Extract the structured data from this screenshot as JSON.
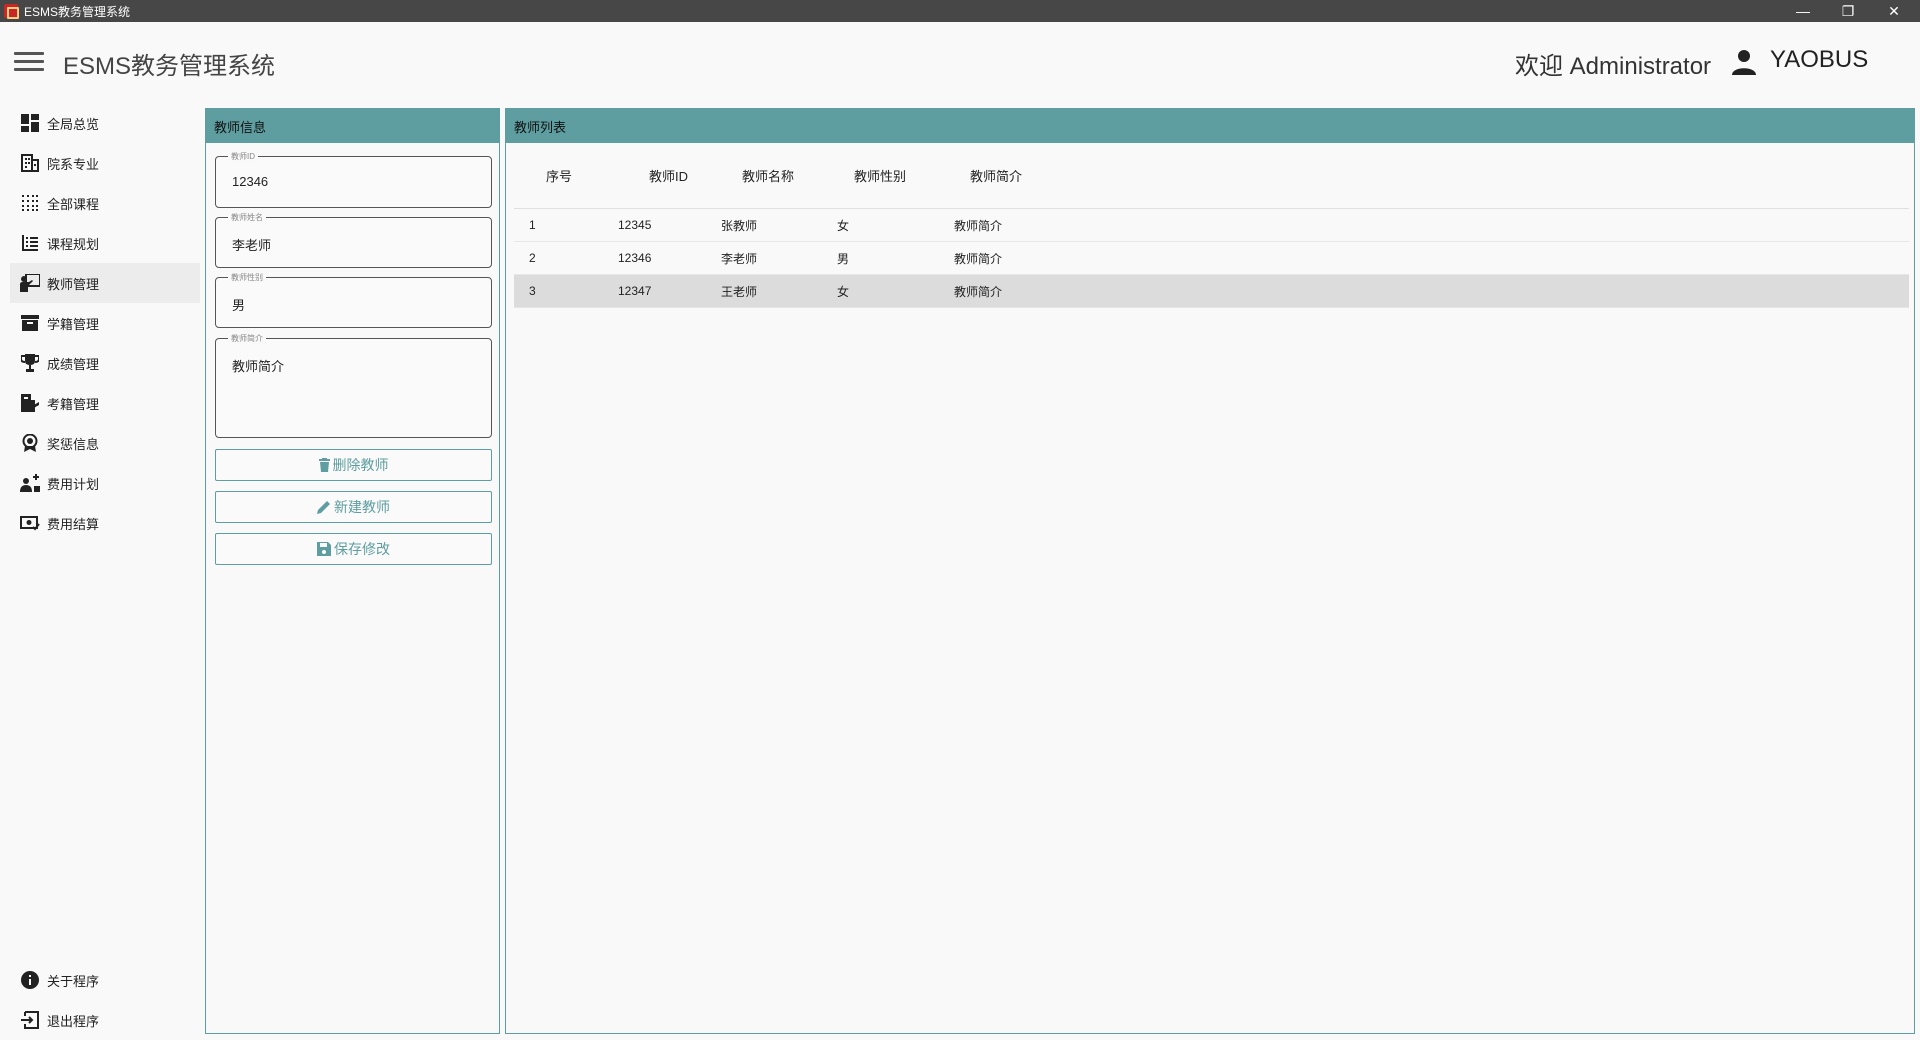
{
  "window": {
    "title": "ESMS教务管理系统",
    "minimize": "—",
    "maximize": "❐",
    "close": "✕"
  },
  "header": {
    "app_title": "ESMS教务管理系统",
    "welcome": "欢迎  Administrator",
    "user_icon": "person-icon",
    "username": "YAOBUS"
  },
  "sidebar": {
    "items": [
      {
        "label": "全局总览",
        "icon": "dashboard-icon"
      },
      {
        "label": "院系专业",
        "icon": "building-icon"
      },
      {
        "label": "全部课程",
        "icon": "grid-dots-icon"
      },
      {
        "label": "课程规划",
        "icon": "list-icon"
      },
      {
        "label": "教师管理",
        "icon": "teacher-icon",
        "active": true
      },
      {
        "label": "学籍管理",
        "icon": "archive-icon"
      },
      {
        "label": "成绩管理",
        "icon": "trophy-icon"
      },
      {
        "label": "考籍管理",
        "icon": "exam-icon"
      },
      {
        "label": "奖惩信息",
        "icon": "award-icon"
      },
      {
        "label": "费用计划",
        "icon": "fee-plan-icon"
      },
      {
        "label": "费用结算",
        "icon": "money-check-icon"
      }
    ],
    "bottom": [
      {
        "label": "关于程序",
        "icon": "info-icon"
      },
      {
        "label": "退出程序",
        "icon": "exit-icon"
      }
    ]
  },
  "teacher_info": {
    "title": "教师信息",
    "fields": {
      "id": {
        "label": "教师ID",
        "value": "12346"
      },
      "name": {
        "label": "教师姓名",
        "value": "李老师"
      },
      "gender": {
        "label": "教师性别",
        "value": "男"
      },
      "intro": {
        "label": "教师简介",
        "value": "教师简介"
      }
    },
    "buttons": {
      "delete": "删除教师",
      "create": "新建教师",
      "save": "保存修改"
    }
  },
  "teacher_list": {
    "title": "教师列表",
    "columns": [
      "序号",
      "教师ID",
      "教师名称",
      "教师性别",
      "教师简介"
    ],
    "rows": [
      [
        "1",
        "12345",
        "张教师",
        "女",
        "教师简介"
      ],
      [
        "2",
        "12346",
        "李老师",
        "男",
        "教师简介"
      ],
      [
        "3",
        "12347",
        "王老师",
        "女",
        "教师简介"
      ]
    ],
    "selected_row": 3
  },
  "colors": {
    "accent": "#5f9ea0",
    "titlebar": "#474747",
    "selected_row": "#dcdcdc"
  }
}
